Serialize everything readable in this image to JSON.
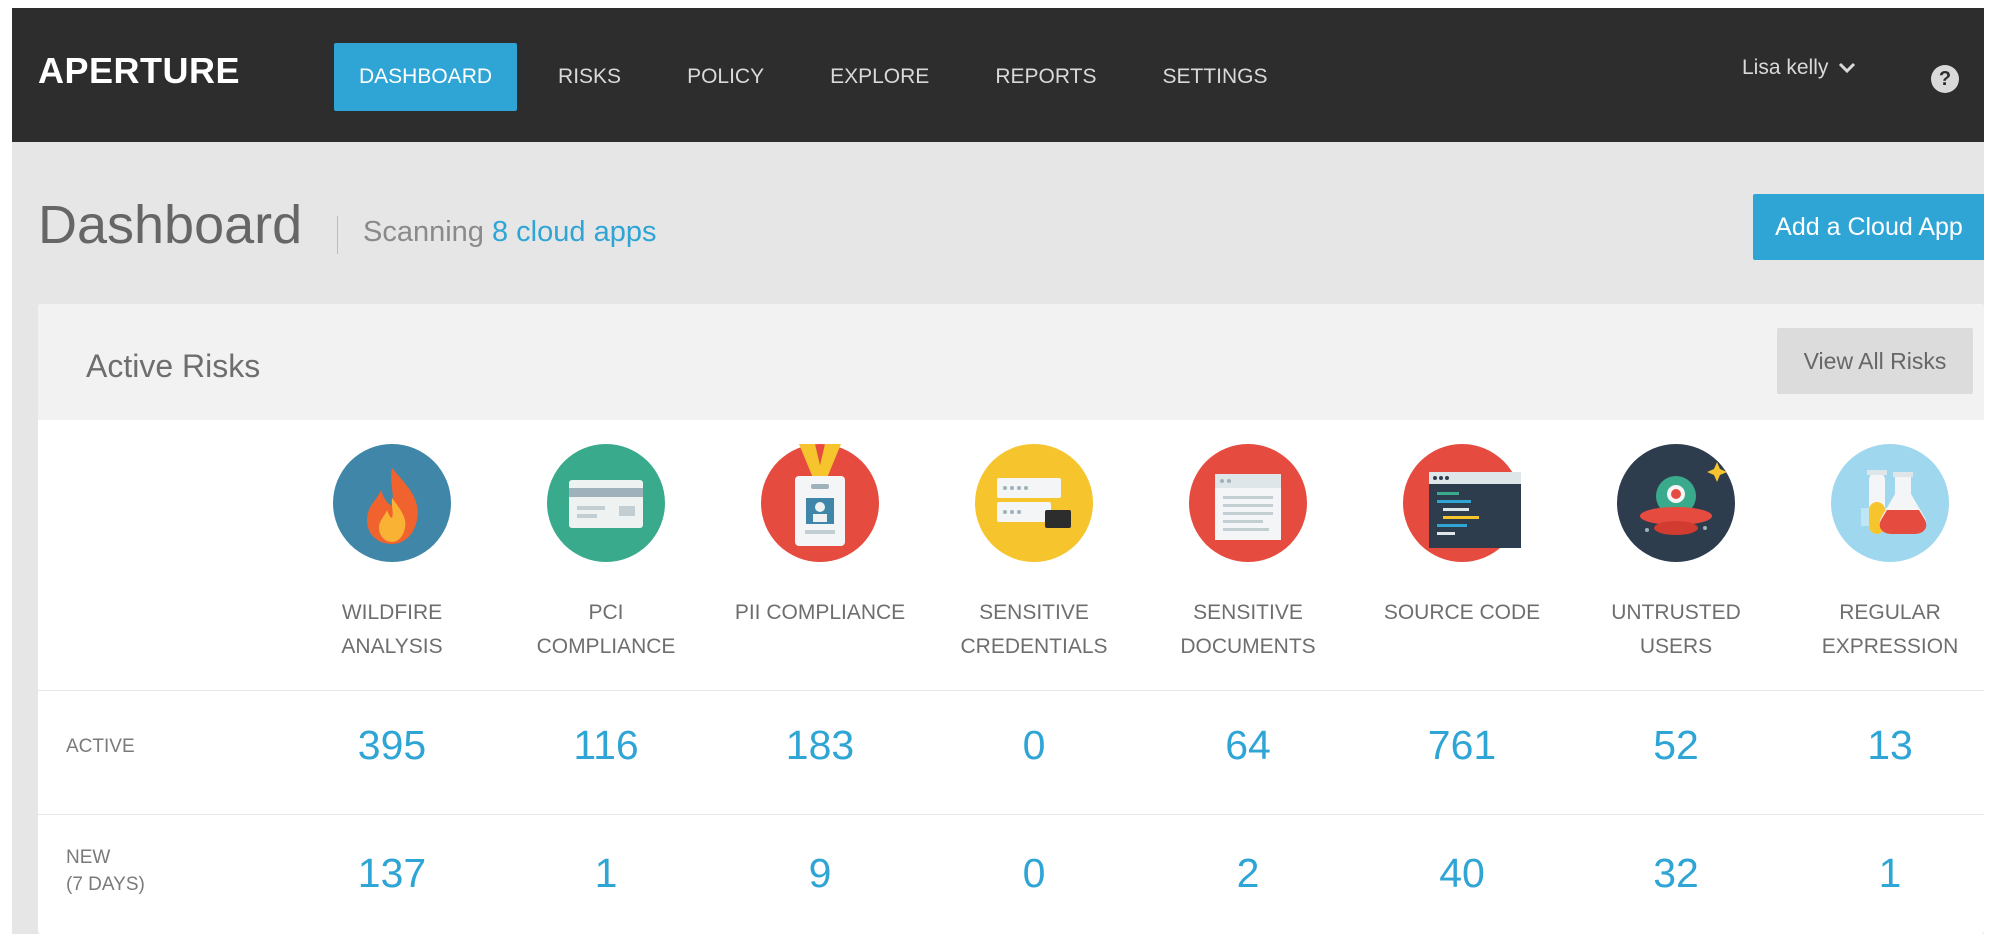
{
  "app": {
    "logo": "APERTURE"
  },
  "nav": {
    "items": [
      {
        "label": "DASHBOARD",
        "active": true
      },
      {
        "label": "RISKS"
      },
      {
        "label": "POLICY"
      },
      {
        "label": "EXPLORE"
      },
      {
        "label": "REPORTS"
      },
      {
        "label": "SETTINGS"
      }
    ],
    "user": "Lisa kelly",
    "help": "?"
  },
  "header": {
    "title": "Dashboard",
    "scanning_prefix": "Scanning",
    "scanning_link": "8 cloud apps",
    "add_button": "Add a Cloud App"
  },
  "panel": {
    "title": "Active Risks",
    "view_all": "View All Risks",
    "row_labels": {
      "active": "ACTIVE",
      "new_line1": "NEW",
      "new_line2": "(7 DAYS)"
    },
    "categories": [
      {
        "line1": "WILDFIRE",
        "line2": "ANALYSIS",
        "active": "395",
        "new": "137",
        "icon": "wildfire-icon",
        "color": "#3f86a8"
      },
      {
        "line1": "PCI",
        "line2": "COMPLIANCE",
        "active": "116",
        "new": "1",
        "icon": "credit-card-icon",
        "color": "#3aaa8c"
      },
      {
        "line1": "PII COMPLIANCE",
        "line2": "",
        "active": "183",
        "new": "9",
        "icon": "id-badge-icon",
        "color": "#e64b3f"
      },
      {
        "line1": "SENSITIVE",
        "line2": "CREDENTIALS",
        "active": "0",
        "new": "0",
        "icon": "credentials-icon",
        "color": "#f6c42c"
      },
      {
        "line1": "SENSITIVE",
        "line2": "DOCUMENTS",
        "active": "64",
        "new": "2",
        "icon": "document-icon",
        "color": "#e64b3f"
      },
      {
        "line1": "SOURCE CODE",
        "line2": "",
        "active": "761",
        "new": "40",
        "icon": "code-window-icon",
        "color": "#e64b3f"
      },
      {
        "line1": "UNTRUSTED",
        "line2": "USERS",
        "active": "52",
        "new": "32",
        "icon": "alien-ufo-icon",
        "color": "#2e3d4e"
      },
      {
        "line1": "REGULAR",
        "line2": "EXPRESSION",
        "active": "13",
        "new": "1",
        "icon": "test-tubes-icon",
        "color": "#9fd8ee"
      }
    ]
  }
}
